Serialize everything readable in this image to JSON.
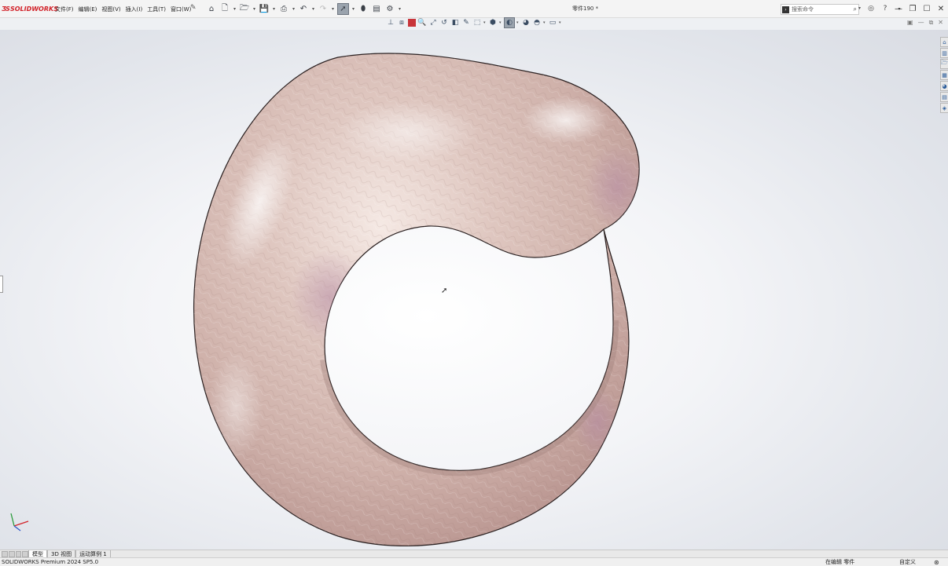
{
  "app": {
    "logo_text": "SOLIDWORKS",
    "doc_title": "零件190 *",
    "search_placeholder": "搜索命令",
    "brand_color": "#d2232a"
  },
  "menu": [
    {
      "label": "文件(F)"
    },
    {
      "label": "编辑(E)"
    },
    {
      "label": "视图(V)"
    },
    {
      "label": "插入(I)"
    },
    {
      "label": "工具(T)"
    },
    {
      "label": "窗口(W)"
    }
  ],
  "toolbar_icons": [
    "home-icon",
    "new-document-icon",
    "open-icon",
    "save-icon",
    "print-icon",
    "undo-icon",
    "redo-icon",
    "select-pointer-icon",
    "rebuild-icon",
    "file-properties-icon",
    "options-gear-icon"
  ],
  "hud_icons": [
    "view-triad-icon",
    "section-view-icon",
    "display-color-icon",
    "zoom-to-fit-icon",
    "zoom-area-icon",
    "previous-view-icon",
    "section-icon",
    "dynamic-annotation-icon",
    "view-orientation-icon",
    "display-style-icon",
    "hide-show-icon",
    "edit-appearance-icon",
    "apply-scene-icon",
    "view-settings-icon"
  ],
  "tabs": [
    {
      "label": "模型",
      "active": true
    },
    {
      "label": "3D 视图",
      "active": false
    },
    {
      "label": "运动算例 1",
      "active": false
    }
  ],
  "status": {
    "version": "SOLIDWORKS Premium 2024 SP5.0",
    "mode": "在编辑 零件",
    "custom": "自定义"
  },
  "model": {
    "surface_color": "#d8bcb4",
    "highlight_color": "#f7ebe6",
    "tint_color": "#b58aa3"
  }
}
